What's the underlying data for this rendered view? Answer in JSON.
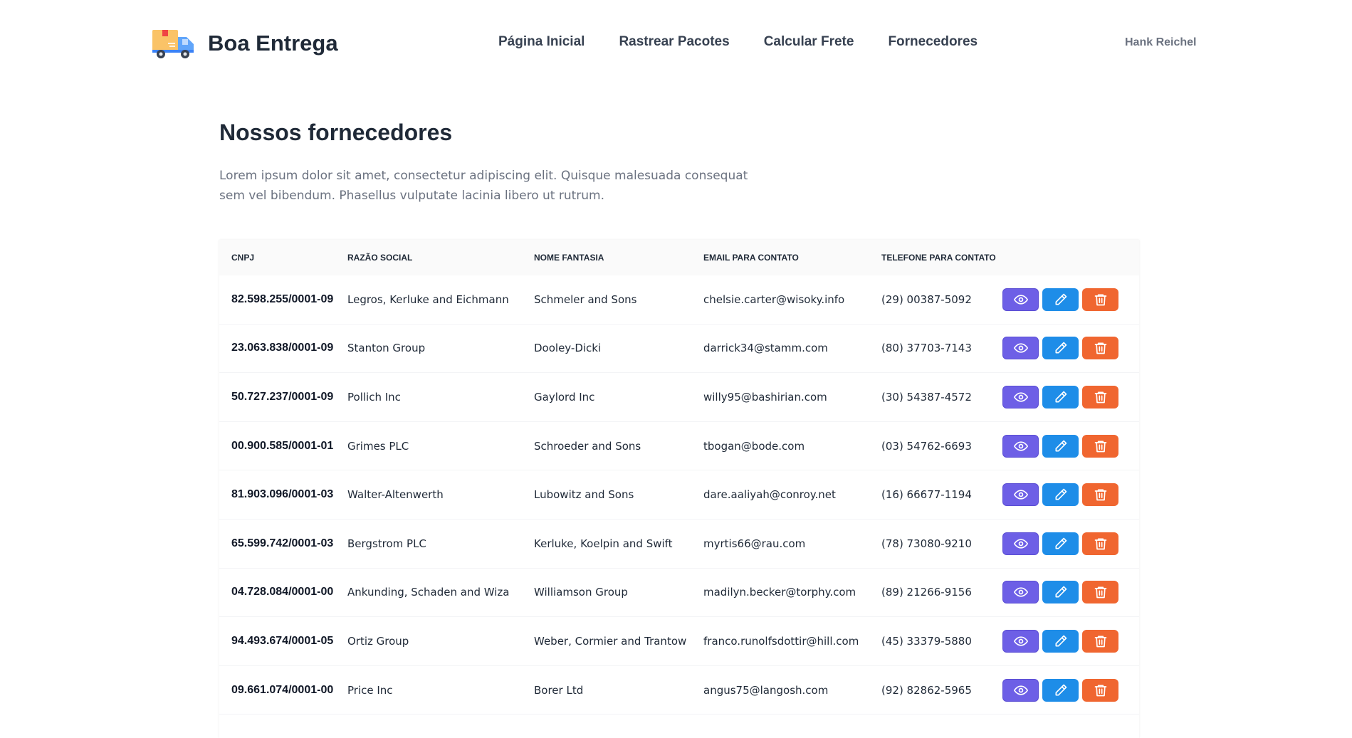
{
  "brand": {
    "name": "Boa Entrega"
  },
  "nav": {
    "links": [
      {
        "label": "Página Inicial"
      },
      {
        "label": "Rastrear Pacotes"
      },
      {
        "label": "Calcular Frete"
      },
      {
        "label": "Fornecedores"
      }
    ],
    "user": "Hank Reichel"
  },
  "main": {
    "title": "Nossos fornecedores",
    "description": "Lorem ipsum dolor sit amet, consectetur adipiscing elit. Quisque malesuada consequat sem vel bibendum. Phasellus vulputate lacinia libero ut rutrum."
  },
  "table": {
    "headers": [
      "CNPJ",
      "Razão Social",
      "Nome Fantasia",
      "Email para contato",
      "Telefone para contato"
    ],
    "rows": [
      [
        "82.598.255/0001-09",
        "Legros, Kerluke and Eichmann",
        "Schmeler and Sons",
        "chelsie.carter@wisoky.info",
        "(29) 00387-5092"
      ],
      [
        "23.063.838/0001-09",
        "Stanton Group",
        "Dooley-Dicki",
        "darrick34@stamm.com",
        "(80) 37703-7143"
      ],
      [
        "50.727.237/0001-09",
        "Pollich Inc",
        "Gaylord Inc",
        "willy95@bashirian.com",
        "(30) 54387-4572"
      ],
      [
        "00.900.585/0001-01",
        "Grimes PLC",
        "Schroeder and Sons",
        "tbogan@bode.com",
        "(03) 54762-6693"
      ],
      [
        "81.903.096/0001-03",
        "Walter-Altenwerth",
        "Lubowitz and Sons",
        "dare.aaliyah@conroy.net",
        "(16) 66677-1194"
      ],
      [
        "65.599.742/0001-03",
        "Bergstrom PLC",
        "Kerluke, Koelpin and Swift",
        "myrtis66@rau.com",
        "(78) 73080-9210"
      ],
      [
        "04.728.084/0001-00",
        "Ankunding, Schaden and Wiza",
        "Williamson Group",
        "madilyn.becker@torphy.com",
        "(89) 21266-9156"
      ],
      [
        "94.493.674/0001-05",
        "Ortiz Group",
        "Weber, Cormier and Trantow",
        "franco.runolfsdottir@hill.com",
        "(45) 33379-5880"
      ],
      [
        "09.661.074/0001-00",
        "Price Inc",
        "Borer Ltd",
        "angus75@langosh.com",
        "(92) 82862-5965"
      ]
    ],
    "actions": {
      "view_icon": "eye-icon",
      "edit_icon": "pencil-icon",
      "delete_icon": "trash-icon"
    }
  },
  "colors": {
    "view": "#6d5fe6",
    "edit": "#1e8de8",
    "delete": "#f06630",
    "logo_box": "#fbbf24",
    "logo_truck": "#60a5fa"
  }
}
